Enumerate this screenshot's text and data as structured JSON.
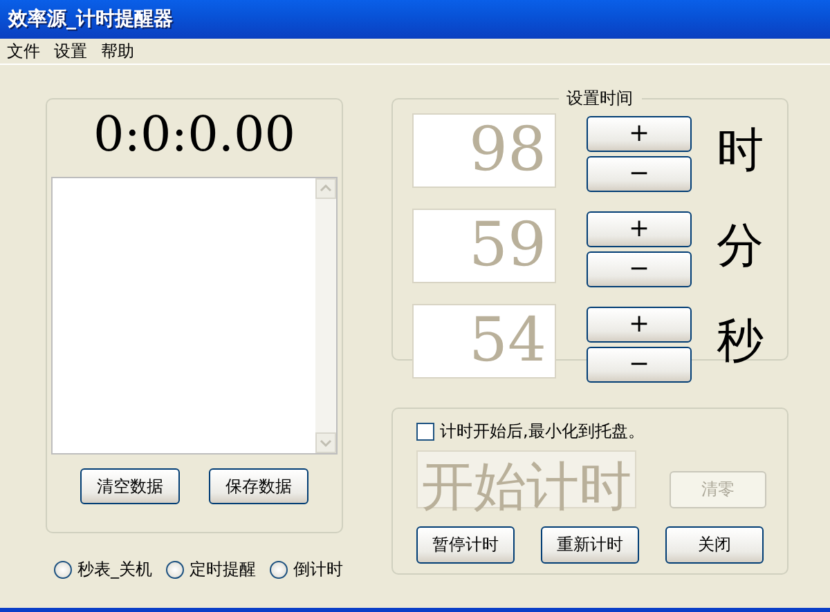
{
  "window": {
    "title": "效率源_计时提醒器"
  },
  "menu": [
    "文件",
    "设置",
    "帮助"
  ],
  "stopwatch": {
    "display": "0:0:0.00",
    "buttons": [
      {
        "label": "清空数据",
        "disabled": false
      },
      {
        "label": "保存数据",
        "disabled": false
      }
    ]
  },
  "modes": [
    {
      "label": "秒表_关机",
      "selected": false
    },
    {
      "label": "定时提醒",
      "selected": false
    },
    {
      "label": "倒计时",
      "selected": false
    }
  ],
  "set_time": {
    "title": "设置时间",
    "units": [
      {
        "value": "98",
        "disabled": true,
        "increment": "+",
        "decrement": "−",
        "unit": "时"
      },
      {
        "value": "59",
        "disabled": true,
        "increment": "+",
        "decrement": "−",
        "unit": "分"
      },
      {
        "value": "54",
        "disabled": true,
        "increment": "+",
        "decrement": "−",
        "unit": "秒"
      }
    ]
  },
  "tray_option": {
    "label": "计时开始后,最小化到托盘。",
    "checked": false
  },
  "start_button": {
    "label": "开始计时",
    "disabled": true
  },
  "clear_button": {
    "label": "清零",
    "disabled": true
  },
  "actions": [
    {
      "label": "暂停计时",
      "disabled": false
    },
    {
      "label": "重新计时",
      "disabled": false
    },
    {
      "label": "关闭",
      "disabled": false
    }
  ]
}
